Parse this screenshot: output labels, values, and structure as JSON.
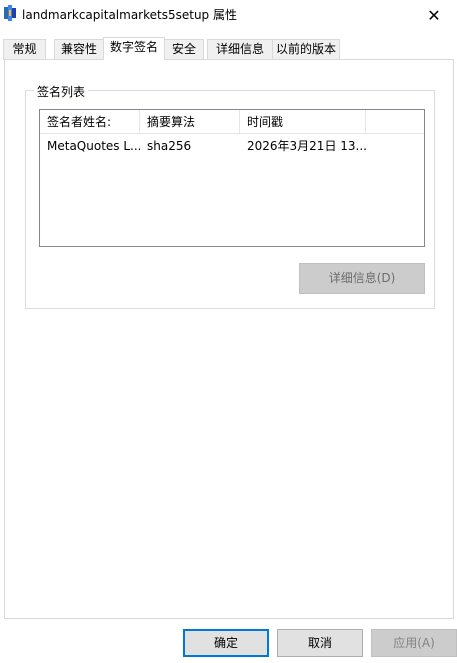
{
  "window": {
    "title": "landmarkcapitalmarkets5setup 属性",
    "close_glyph": "✕",
    "icon": "installer-app-icon"
  },
  "tabs": [
    {
      "label": "常规",
      "active": false
    },
    {
      "label": "兼容性",
      "active": false
    },
    {
      "label": "数字签名",
      "active": true
    },
    {
      "label": "安全",
      "active": false
    },
    {
      "label": "详细信息",
      "active": false
    },
    {
      "label": "以前的版本",
      "active": false
    }
  ],
  "signature_list": {
    "group_label": "签名列表",
    "columns": [
      "签名者姓名:",
      "摘要算法",
      "时间戳"
    ],
    "rows": [
      {
        "signer": "MetaQuotes L...",
        "algorithm": "sha256",
        "timestamp": "2026年3月21日 13..."
      }
    ],
    "details_button": "详细信息(D)"
  },
  "footer": {
    "ok": "确定",
    "cancel": "取消",
    "apply": "应用(A)"
  },
  "colors": {
    "accent": "#0078d7",
    "disabled_bg": "#cccccc",
    "button_bg": "#e1e1e1"
  }
}
